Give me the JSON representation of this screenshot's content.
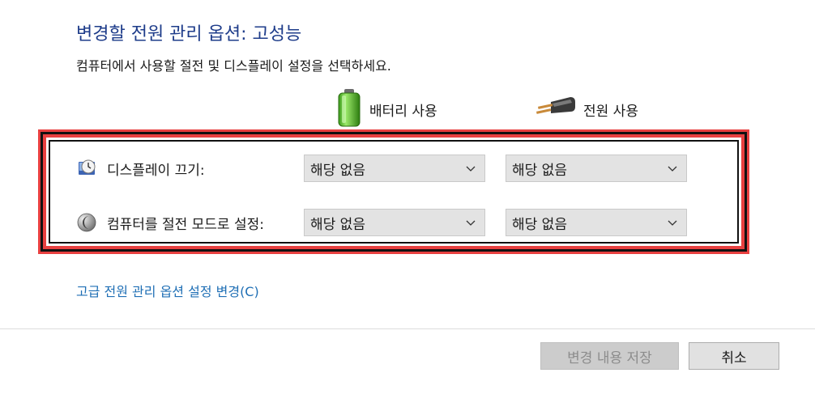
{
  "page": {
    "title": "변경할 전원 관리 옵션: 고성능",
    "subtitle": "컴퓨터에서 사용할 절전 및 디스플레이 설정을 선택하세요."
  },
  "columns": {
    "battery_label": "배터리 사용",
    "battery_icon": "battery-icon",
    "plugged_label": "전원 사용",
    "plugged_icon": "power-plug-icon"
  },
  "settings": {
    "display": {
      "label": "디스플레이 끄기:",
      "icon": "display-clock-icon",
      "battery_value": "해당 없음",
      "plugged_value": "해당 없음"
    },
    "sleep": {
      "label": "컴퓨터를 절전 모드로 설정:",
      "icon": "moon-sleep-icon",
      "battery_value": "해당 없음",
      "plugged_value": "해당 없음"
    }
  },
  "links": {
    "advanced": "고급 전원 관리 옵션 설정 변경(C)"
  },
  "buttons": {
    "save": "변경 내용 저장",
    "cancel": "취소"
  },
  "colors": {
    "title": "#1e3c8a",
    "link": "#1f6fb5",
    "highlight": "#e84040"
  }
}
